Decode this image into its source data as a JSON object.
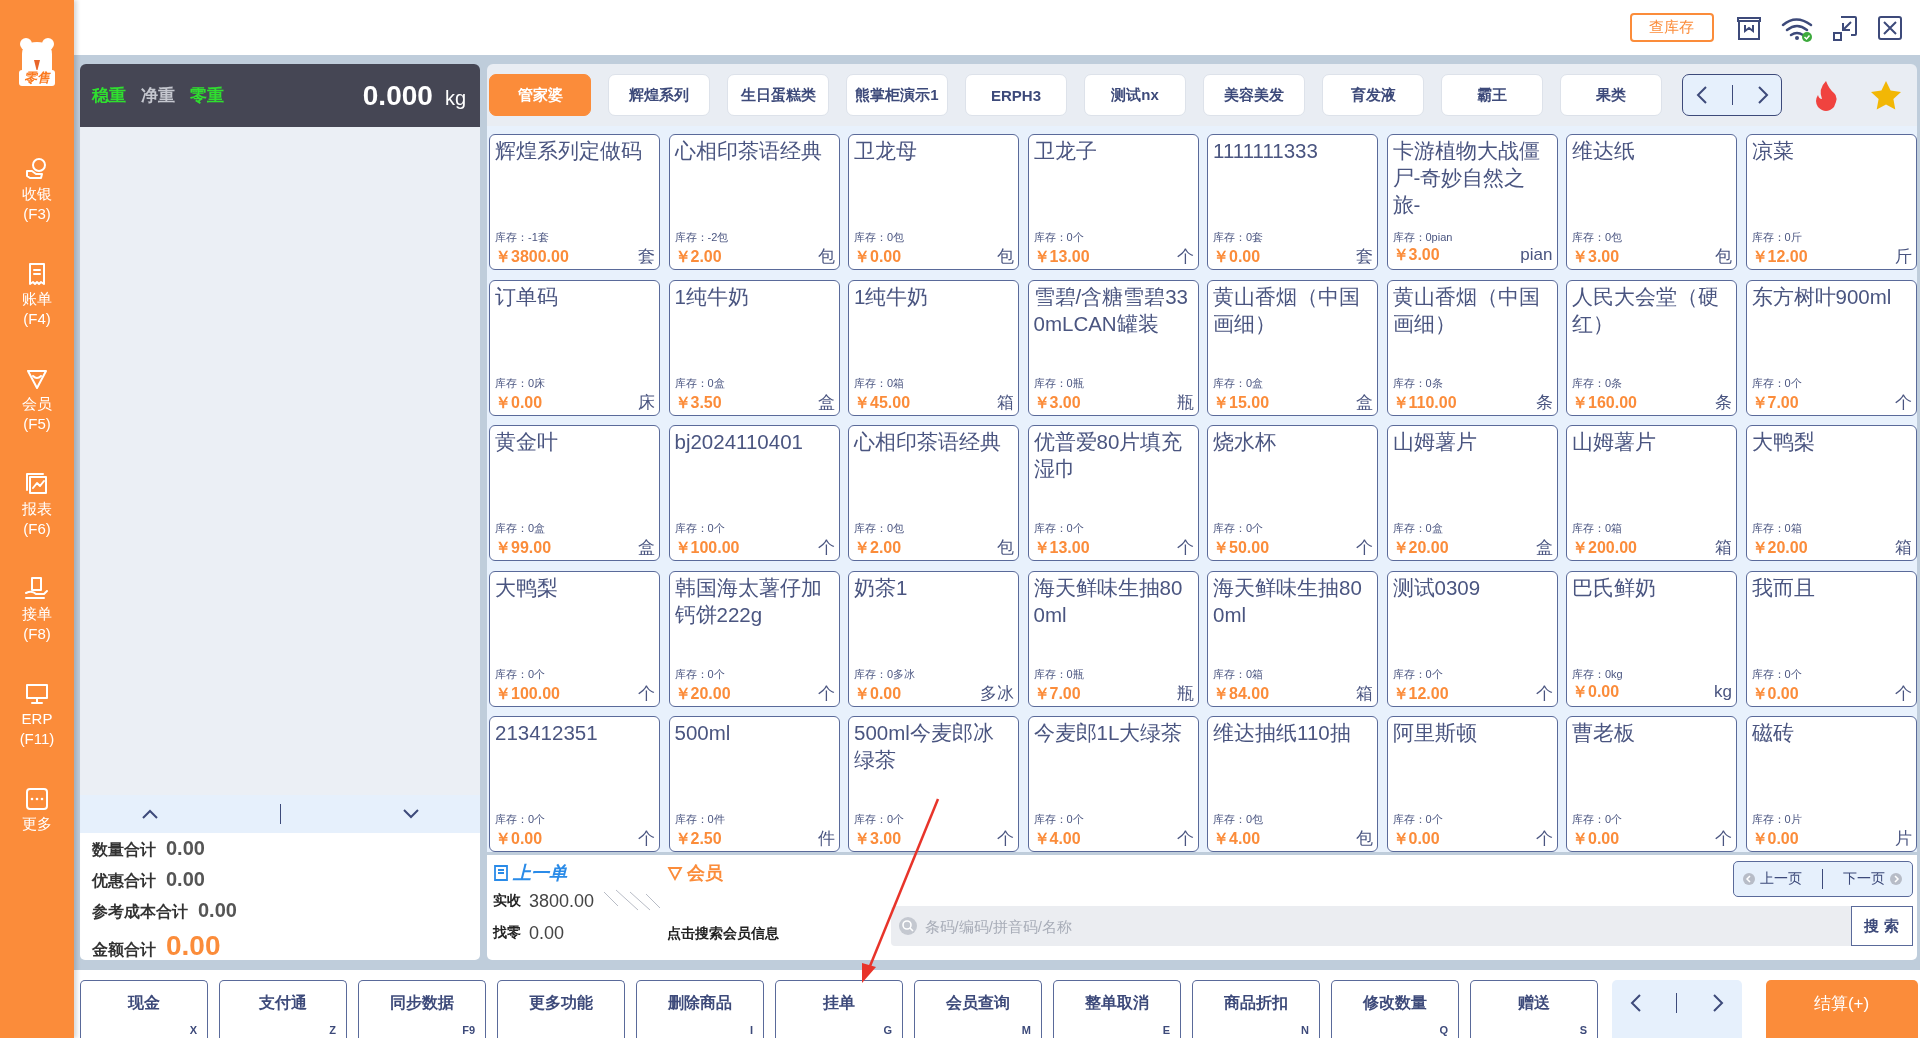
{
  "brand": {
    "badge": "零售"
  },
  "sidebar": {
    "items": [
      {
        "label": "收银",
        "shortcut": "(F3)"
      },
      {
        "label": "账单",
        "shortcut": "(F4)"
      },
      {
        "label": "会员",
        "shortcut": "(F5)"
      },
      {
        "label": "报表",
        "shortcut": "(F6)"
      },
      {
        "label": "接单",
        "shortcut": "(F8)"
      },
      {
        "label": "ERP",
        "shortcut": "(F11)"
      },
      {
        "label": "更多"
      }
    ]
  },
  "top_bar": {
    "stock_button": "查库存"
  },
  "scale": {
    "flags": [
      {
        "label": "稳重",
        "on": true
      },
      {
        "label": "净重",
        "on": false
      },
      {
        "label": "零重",
        "on": true
      }
    ],
    "weight": "0.000",
    "unit": "kg"
  },
  "totals": [
    {
      "label": "数量合计",
      "value": "0.00",
      "kind": "sum"
    },
    {
      "label": "优惠合计",
      "value": "0.00",
      "kind": "sum"
    },
    {
      "label": "参考成本合计",
      "value": "0.00",
      "kind": "sum"
    },
    {
      "label": "金额合计",
      "value": "0.00",
      "kind": "total"
    }
  ],
  "categories": [
    {
      "label": "管家婆",
      "selected": true
    },
    {
      "label": "辉煌系列",
      "selected": false
    },
    {
      "label": "生日蛋糕类",
      "selected": false
    },
    {
      "label": "熊掌柜演示1",
      "selected": false
    },
    {
      "label": "ERPH3",
      "selected": false
    },
    {
      "label": "测试nx",
      "selected": false
    },
    {
      "label": "美容美发",
      "selected": false
    },
    {
      "label": "育发液",
      "selected": false
    },
    {
      "label": "霸王",
      "selected": false
    },
    {
      "label": "果类",
      "selected": false
    }
  ],
  "products": [
    {
      "name": "辉煌系列定做码",
      "stock": "库存：-1套",
      "price": "￥3800.00",
      "unit": "套"
    },
    {
      "name": "心相印茶语经典",
      "stock": "库存：-2包",
      "price": "￥2.00",
      "unit": "包"
    },
    {
      "name": "卫龙母",
      "stock": "库存：0包",
      "price": "￥0.00",
      "unit": "包"
    },
    {
      "name": "卫龙子",
      "stock": "库存：0个",
      "price": "￥13.00",
      "unit": "个"
    },
    {
      "name": "1111111333",
      "stock": "库存：0套",
      "price": "￥0.00",
      "unit": "套"
    },
    {
      "name": "卡游植物大战僵尸-奇妙自然之旅-",
      "stock": "库存：0pian",
      "price": "￥3.00",
      "unit": "pian"
    },
    {
      "name": "维达纸",
      "stock": "库存：0包",
      "price": "￥3.00",
      "unit": "包"
    },
    {
      "name": "凉菜",
      "stock": "库存：0斤",
      "price": "￥12.00",
      "unit": "斤"
    },
    {
      "name": "订单码",
      "stock": "库存：0床",
      "price": "￥0.00",
      "unit": "床"
    },
    {
      "name": "1纯牛奶",
      "stock": "库存：0盒",
      "price": "￥3.50",
      "unit": "盒"
    },
    {
      "name": "1纯牛奶",
      "stock": "库存：0箱",
      "price": "￥45.00",
      "unit": "箱"
    },
    {
      "name": "雪碧/含糖雪碧330mLCAN罐装",
      "stock": "库存：0瓶",
      "price": "￥3.00",
      "unit": "瓶"
    },
    {
      "name": "黄山香烟（中国画细）",
      "stock": "库存：0盒",
      "price": "￥15.00",
      "unit": "盒"
    },
    {
      "name": "黄山香烟（中国画细）",
      "stock": "库存：0条",
      "price": "￥110.00",
      "unit": "条"
    },
    {
      "name": "人民大会堂（硬红）",
      "stock": "库存：0条",
      "price": "￥160.00",
      "unit": "条"
    },
    {
      "name": "东方树叶900ml",
      "stock": "库存：0个",
      "price": "￥7.00",
      "unit": "个"
    },
    {
      "name": "黄金叶",
      "stock": "库存：0盒",
      "price": "￥99.00",
      "unit": "盒"
    },
    {
      "name": "bj2024110401",
      "stock": "库存：0个",
      "price": "￥100.00",
      "unit": "个"
    },
    {
      "name": "心相印茶语经典",
      "stock": "库存：0包",
      "price": "￥2.00",
      "unit": "包"
    },
    {
      "name": "优普爱80片填充湿巾",
      "stock": "库存：0个",
      "price": "￥13.00",
      "unit": "个"
    },
    {
      "name": "烧水杯",
      "stock": "库存：0个",
      "price": "￥50.00",
      "unit": "个"
    },
    {
      "name": "山姆薯片",
      "stock": "库存：0盒",
      "price": "￥20.00",
      "unit": "盒"
    },
    {
      "name": "山姆薯片",
      "stock": "库存：0箱",
      "price": "￥200.00",
      "unit": "箱"
    },
    {
      "name": "大鸭梨",
      "stock": "库存：0箱",
      "price": "￥20.00",
      "unit": "箱"
    },
    {
      "name": "大鸭梨",
      "stock": "库存：0个",
      "price": "￥100.00",
      "unit": "个"
    },
    {
      "name": "韩国海太薯仔加钙饼222g",
      "stock": "库存：0个",
      "price": "￥20.00",
      "unit": "个"
    },
    {
      "name": "奶茶1",
      "stock": "库存：0多冰",
      "price": "￥0.00",
      "unit": "多冰"
    },
    {
      "name": "海天鲜味生抽800ml",
      "stock": "库存：0瓶",
      "price": "￥7.00",
      "unit": "瓶"
    },
    {
      "name": "海天鲜味生抽800ml",
      "stock": "库存：0箱",
      "price": "￥84.00",
      "unit": "箱"
    },
    {
      "name": "测试0309",
      "stock": "库存：0个",
      "price": "￥12.00",
      "unit": "个"
    },
    {
      "name": "巴氏鲜奶",
      "stock": "库存：0kg",
      "price": "￥0.00",
      "unit": "kg"
    },
    {
      "name": "我而且",
      "stock": "库存：0个",
      "price": "￥0.00",
      "unit": "个"
    },
    {
      "name": "213412351",
      "stock": "库存：0个",
      "price": "￥0.00",
      "unit": "个"
    },
    {
      "name": "500ml",
      "stock": "库存：0件",
      "price": "￥2.50",
      "unit": "件"
    },
    {
      "name": "500ml今麦郎冰绿茶",
      "stock": "库存：0个",
      "price": "￥3.00",
      "unit": "个"
    },
    {
      "name": "今麦郎1L大绿茶",
      "stock": "库存：0个",
      "price": "￥4.00",
      "unit": "个"
    },
    {
      "name": "维达抽纸110抽",
      "stock": "库存：0包",
      "price": "￥4.00",
      "unit": "包"
    },
    {
      "name": "阿里斯顿",
      "stock": "库存：0个",
      "price": "￥0.00",
      "unit": "个"
    },
    {
      "name": "曹老板",
      "stock": "库存：0个",
      "price": "￥0.00",
      "unit": "个"
    },
    {
      "name": "磁砖",
      "stock": "库存：0片",
      "price": "￥0.00",
      "unit": "片"
    }
  ],
  "order_panel": {
    "last_order": "上一单",
    "member": "会员",
    "received": {
      "label": "实收",
      "value": "3800.00"
    },
    "change": {
      "label": "找零",
      "value": "0.00"
    },
    "member_hint": "点击搜索会员信息",
    "pager": [
      "上一页",
      "下一页"
    ],
    "search": {
      "placeholder": "条码/编码/拼音码/名称",
      "button": "搜 索"
    }
  },
  "actions": [
    {
      "label": "现金",
      "key": "X"
    },
    {
      "label": "支付通",
      "key": "Z"
    },
    {
      "label": "同步数据",
      "key": "F9"
    },
    {
      "label": "更多功能"
    },
    {
      "label": "删除商品",
      "key": "I"
    },
    {
      "label": "挂单",
      "key": "G"
    },
    {
      "label": "会员查询",
      "key": "M"
    },
    {
      "label": "整单取消",
      "key": "E"
    },
    {
      "label": "商品折扣",
      "key": "N"
    },
    {
      "label": "修改数量",
      "key": "Q"
    },
    {
      "label": "赠送",
      "key": "S"
    }
  ],
  "checkout": "结算(+)"
}
